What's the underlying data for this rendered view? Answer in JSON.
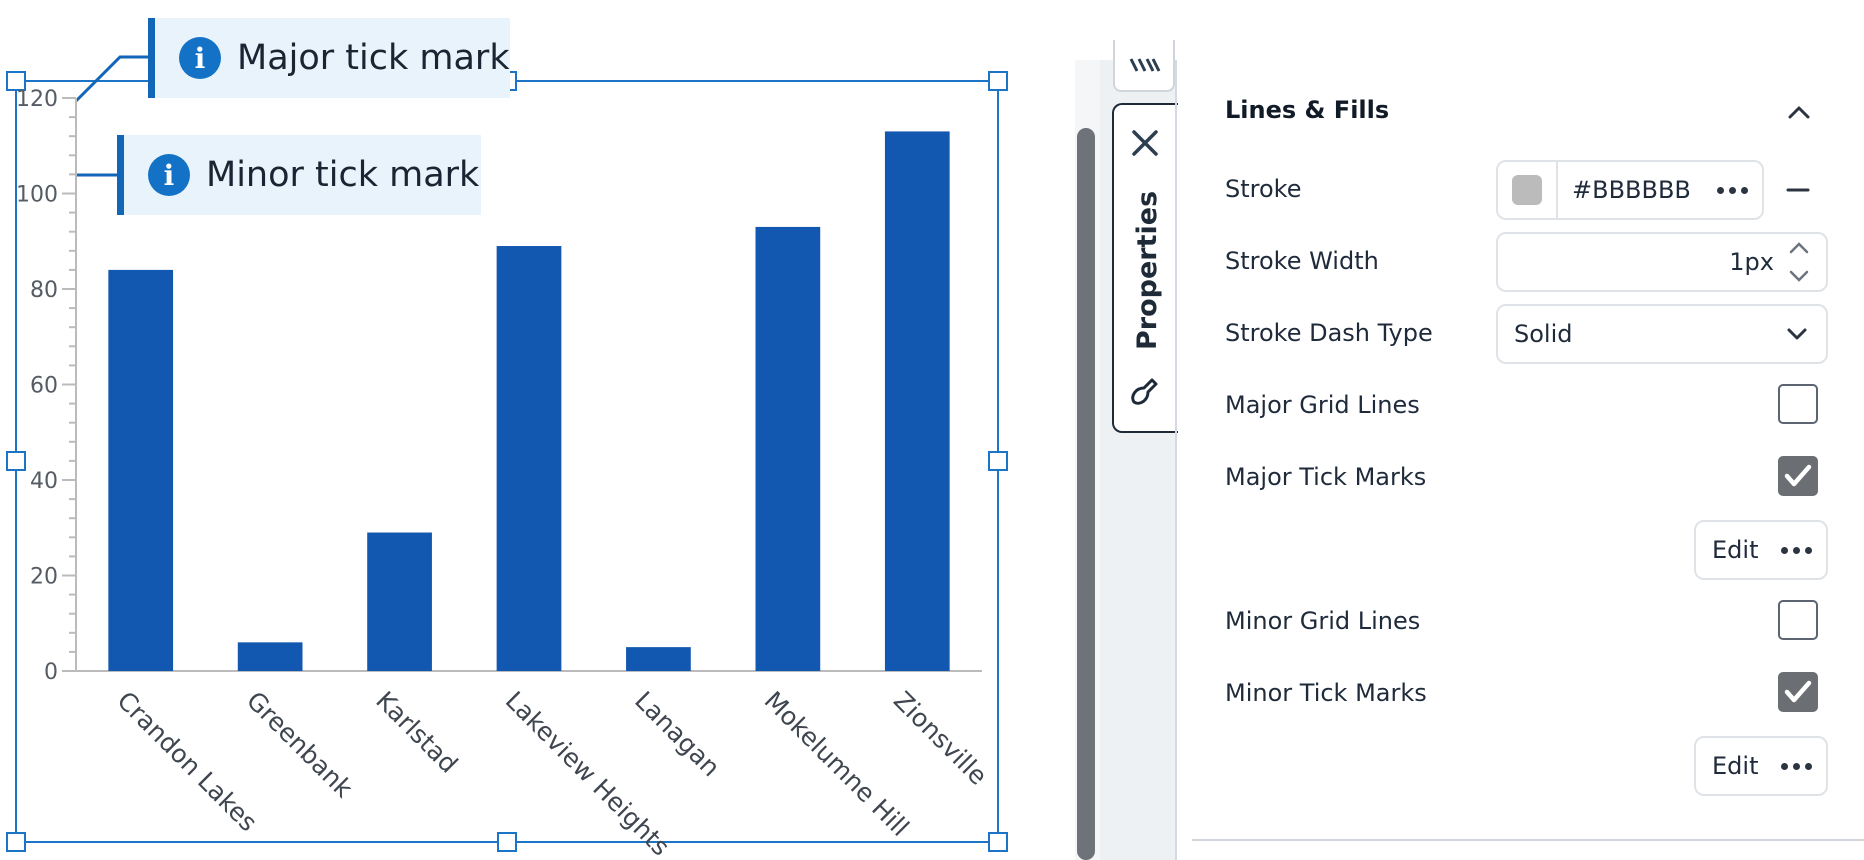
{
  "callouts": {
    "major": "Major tick mark",
    "minor": "Minor tick mark",
    "info_icon": "i"
  },
  "chart_data": {
    "type": "bar",
    "categories": [
      "Crandon Lakes",
      "Greenbank",
      "Karlstad",
      "Lakeview Heights",
      "Lanagan",
      "Mokelumne Hill",
      "Zionsville"
    ],
    "values": [
      84,
      6,
      29,
      89,
      5,
      93,
      113
    ],
    "ylim": [
      0,
      120
    ],
    "yticks": [
      0,
      20,
      40,
      60,
      80,
      100,
      120
    ],
    "minor_tick_step": 4,
    "bar_color": "#1257b0",
    "axis_color": "#BBBBBB",
    "grid": false,
    "title": "",
    "xlabel": "",
    "ylabel": ""
  },
  "side_tabs": {
    "top_icon": "data-icon",
    "close_icon": "close-icon",
    "properties_label": "Properties",
    "properties_icon": "brush-icon"
  },
  "panel": {
    "section_title": "Lines & Fills",
    "collapse_icon": "chevron-up-icon",
    "stroke": {
      "label": "Stroke",
      "value": "#BBBBBB",
      "swatch_color": "#BBBBBB",
      "remove_icon": "minus-icon"
    },
    "stroke_width": {
      "label": "Stroke Width",
      "value": "1px"
    },
    "stroke_dash": {
      "label": "Stroke Dash Type",
      "value": "Solid"
    },
    "major_grid": {
      "label": "Major Grid Lines",
      "checked": false
    },
    "major_ticks": {
      "label": "Major Tick Marks",
      "checked": true,
      "edit_label": "Edit"
    },
    "minor_grid": {
      "label": "Minor Grid Lines",
      "checked": false
    },
    "minor_ticks": {
      "label": "Minor Tick Marks",
      "checked": true,
      "edit_label": "Edit"
    }
  },
  "colors": {
    "accent": "#1372c6",
    "selection": "#1b74c5",
    "callout_bg": "#e9f3fb",
    "checked": "#6b6f73"
  }
}
